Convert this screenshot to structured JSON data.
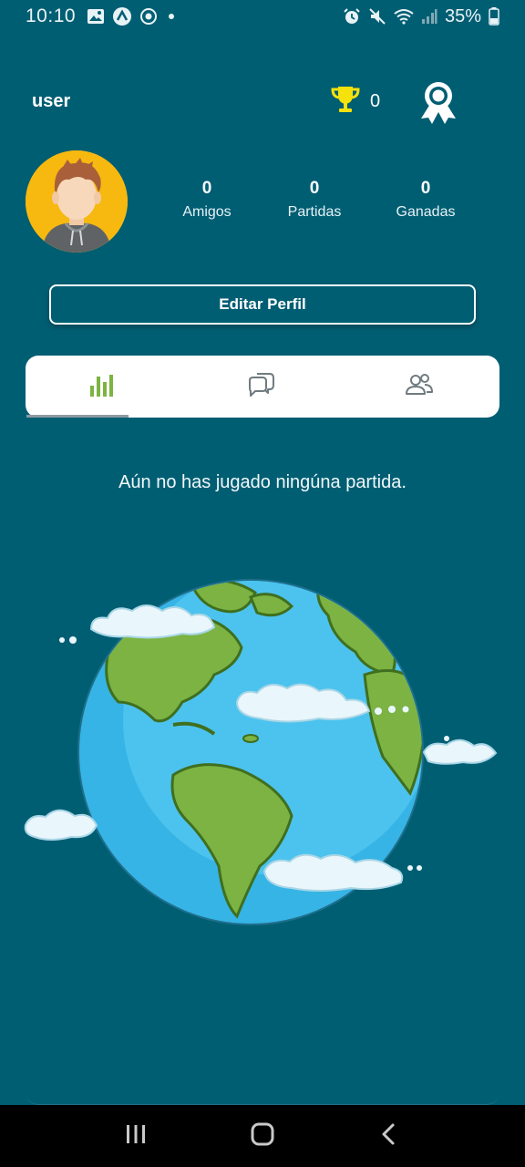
{
  "status_bar": {
    "time": "10:10",
    "battery_percent": "35%",
    "icons_left": [
      "image-icon",
      "app-icon",
      "target-icon"
    ],
    "icons_right": [
      "alarm-icon",
      "mute-icon",
      "wifi-icon",
      "signal-icon",
      "battery-icon"
    ]
  },
  "header": {
    "username": "user",
    "trophy_count": "0",
    "trophy_color": "#f5e10c",
    "achievements_icon": "award-ribbon-icon"
  },
  "stats": [
    {
      "value": "0",
      "label": "Amigos"
    },
    {
      "value": "0",
      "label": "Partidas"
    },
    {
      "value": "0",
      "label": "Ganadas"
    }
  ],
  "profile": {
    "edit_button_label": "Editar Perfil",
    "avatar_background": "#f7b90f"
  },
  "tabs": [
    {
      "icon": "bar-chart-icon",
      "selected": true
    },
    {
      "icon": "chat-bubbles-icon",
      "selected": false
    },
    {
      "icon": "users-icon",
      "selected": false
    }
  ],
  "empty_state": {
    "message": "Aún no has jugado ningúna partida.",
    "illustration": "earth-globe-illustration"
  },
  "nav_bar": {
    "buttons": [
      "recent-apps-icon",
      "home-icon",
      "back-icon"
    ]
  },
  "colors": {
    "background": "#005e73",
    "accent_green": "#7cb342",
    "card": "#ffffff"
  }
}
